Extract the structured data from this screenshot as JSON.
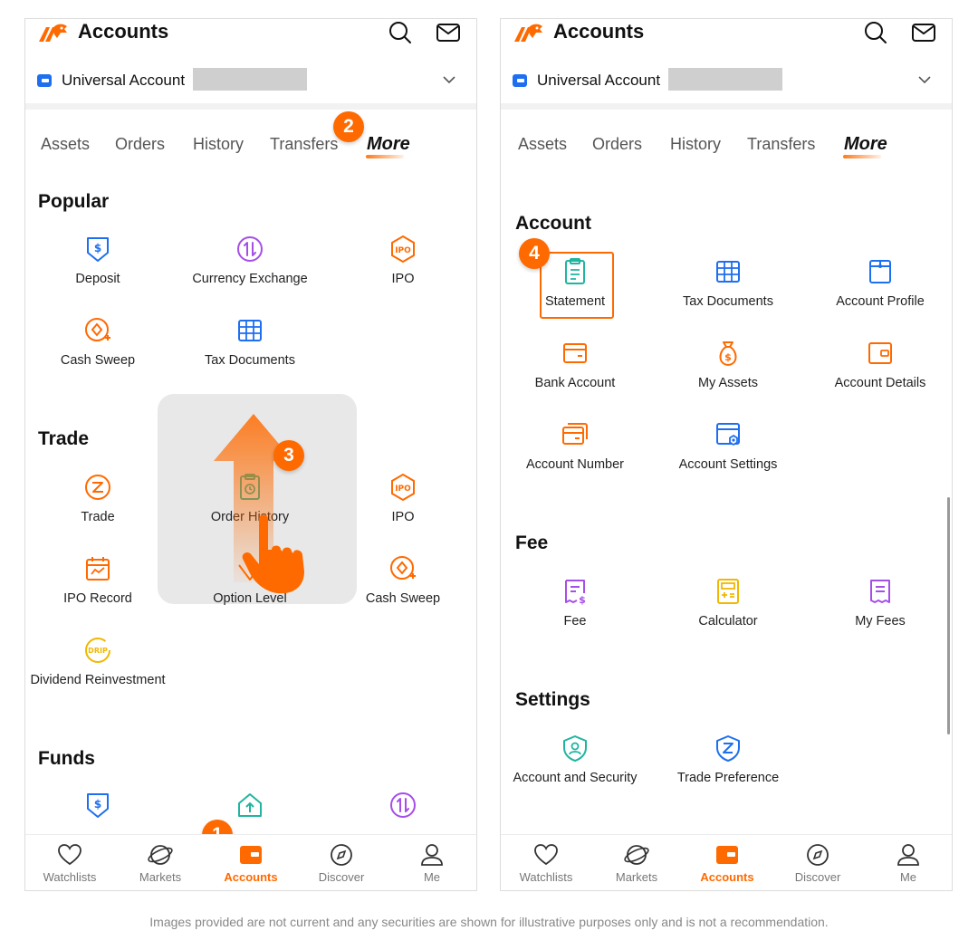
{
  "left": {
    "app_title": "Accounts",
    "account_name": "Universal Account",
    "tabs": [
      "Assets",
      "Orders",
      "History",
      "Transfers",
      "More"
    ],
    "sections": {
      "popular": {
        "title": "Popular",
        "items": [
          "Deposit",
          "Currency Exchange",
          "IPO",
          "Cash Sweep",
          "Tax Documents"
        ]
      },
      "trade": {
        "title": "Trade",
        "items": [
          "Trade",
          "Order History",
          "IPO",
          "IPO  Record",
          "Option Level",
          "Cash Sweep",
          "Dividend Reinvestment"
        ]
      },
      "funds": {
        "title": "Funds"
      }
    },
    "steps": [
      "1",
      "2",
      "3"
    ]
  },
  "right": {
    "app_title": "Accounts",
    "account_name": "Universal Account",
    "tabs": [
      "Assets",
      "Orders",
      "History",
      "Transfers",
      "More"
    ],
    "sections": {
      "account": {
        "title": "Account",
        "items": [
          "Statement",
          "Tax Documents",
          "Account Profile",
          "Bank Account",
          "My Assets",
          "Account Details",
          "Account Number",
          "Account Settings"
        ]
      },
      "fee": {
        "title": "Fee",
        "items": [
          "Fee",
          "Calculator",
          "My Fees"
        ]
      },
      "settings": {
        "title": "Settings",
        "items": [
          "Account and Security",
          "Trade Preference"
        ]
      }
    },
    "steps": [
      "4"
    ]
  },
  "nav": [
    "Watchlists",
    "Markets",
    "Accounts",
    "Discover",
    "Me"
  ],
  "active_nav": "Accounts",
  "icon_names": {
    "deposit": "deposit-icon",
    "currency_exchange": "currency-exchange-icon",
    "ipo": "ipo-icon",
    "cash_sweep": "cash-sweep-icon",
    "tax_documents": "tax-documents-icon",
    "trade": "trade-icon",
    "order_history": "order-history-icon",
    "ipo_record": "ipo-record-icon",
    "option_level": "option-level-icon",
    "dividend_reinvestment": "drip-icon",
    "statement": "statement-icon",
    "account_profile": "account-profile-icon",
    "bank_account": "bank-account-icon",
    "my_assets": "money-bag-icon",
    "account_details": "account-details-icon",
    "account_number": "account-number-icon",
    "account_settings": "account-settings-icon",
    "fee": "fee-icon",
    "calculator": "calculator-icon",
    "my_fees": "my-fees-icon",
    "account_security": "shield-icon",
    "trade_preference": "trade-preference-icon"
  },
  "colors": {
    "accent": "#ff6a00",
    "blue": "#1e6ff0",
    "purple": "#a64ee8",
    "teal": "#1fb5a0",
    "yellow": "#f0b800"
  },
  "disclaimer": "Images provided are not current and any securities are shown for illustrative purposes only and is not a recommendation."
}
